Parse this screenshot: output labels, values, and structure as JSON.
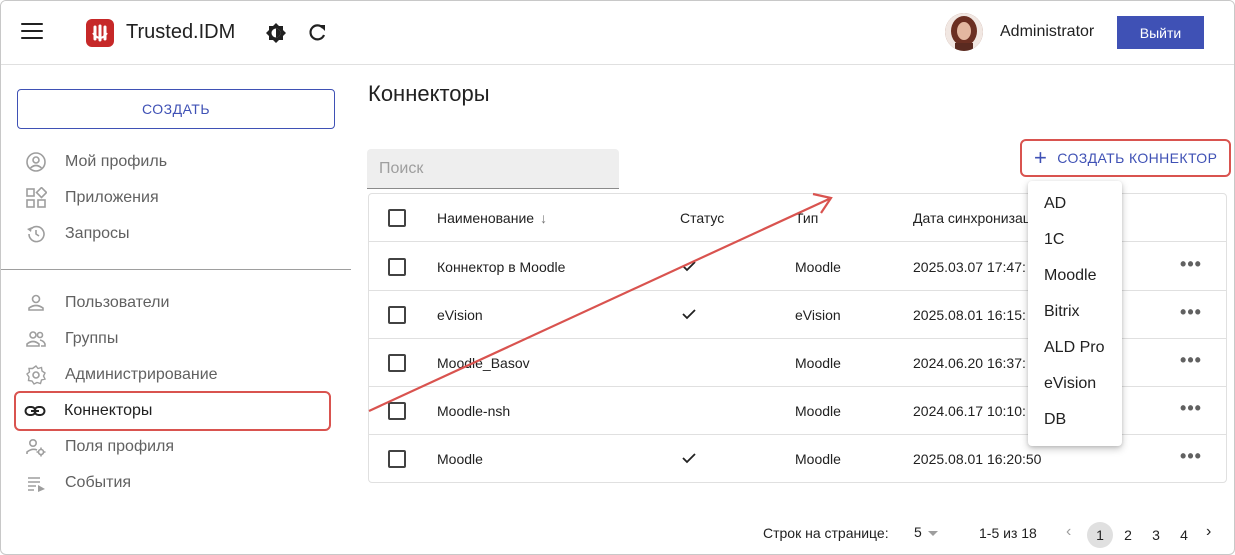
{
  "header": {
    "app_title": "Trusted.IDM",
    "user_name": "Administrator",
    "logout_label": "Выйти"
  },
  "sidebar": {
    "create_label": "СОЗДАТЬ",
    "items": [
      {
        "label": "Мой профиль",
        "icon": "account-circle-icon"
      },
      {
        "label": "Приложения",
        "icon": "apps-grid-icon"
      },
      {
        "label": "Запросы",
        "icon": "history-icon"
      },
      {
        "label": "Пользователи",
        "icon": "person-icon"
      },
      {
        "label": "Группы",
        "icon": "group-icon"
      },
      {
        "label": "Администрирование",
        "icon": "gear-icon"
      },
      {
        "label": "Коннекторы",
        "icon": "link-icon"
      },
      {
        "label": "Поля профиля",
        "icon": "profile-fields-icon"
      },
      {
        "label": "События",
        "icon": "events-list-icon"
      }
    ]
  },
  "main": {
    "page_title": "Коннекторы",
    "search_placeholder": "Поиск",
    "create_connector_label": "СОЗДАТЬ КОННЕКТОР",
    "table": {
      "columns": {
        "name": "Наименование",
        "status": "Статус",
        "type": "Тип",
        "date": "Дата синхронизации"
      },
      "rows": [
        {
          "name": "Коннектор в Moodle",
          "status": true,
          "type": "Moodle",
          "date": "2025.03.07 17:47:"
        },
        {
          "name": "eVision",
          "status": true,
          "type": "eVision",
          "date": "2025.08.01 16:15:"
        },
        {
          "name": "Moodle_Basov",
          "status": false,
          "type": "Moodle",
          "date": "2024.06.20 16:37:"
        },
        {
          "name": "Moodle-nsh",
          "status": false,
          "type": "Moodle",
          "date": "2024.06.17 10:10:"
        },
        {
          "name": "Moodle",
          "status": true,
          "type": "Moodle",
          "date": "2025.08.01 16:20:50"
        }
      ]
    },
    "dropdown_items": [
      "AD",
      "1C",
      "Moodle",
      "Bitrix",
      "ALD Pro",
      "eVision",
      "DB"
    ]
  },
  "pagination": {
    "rows_label": "Строк на странице:",
    "rows_value": "5",
    "range": "1-5 из 18",
    "pages": [
      "1",
      "2",
      "3",
      "4"
    ],
    "current_page": "1"
  },
  "colors": {
    "accent": "#3f51b5",
    "highlight": "#d9534f",
    "logo": "#c62828"
  }
}
